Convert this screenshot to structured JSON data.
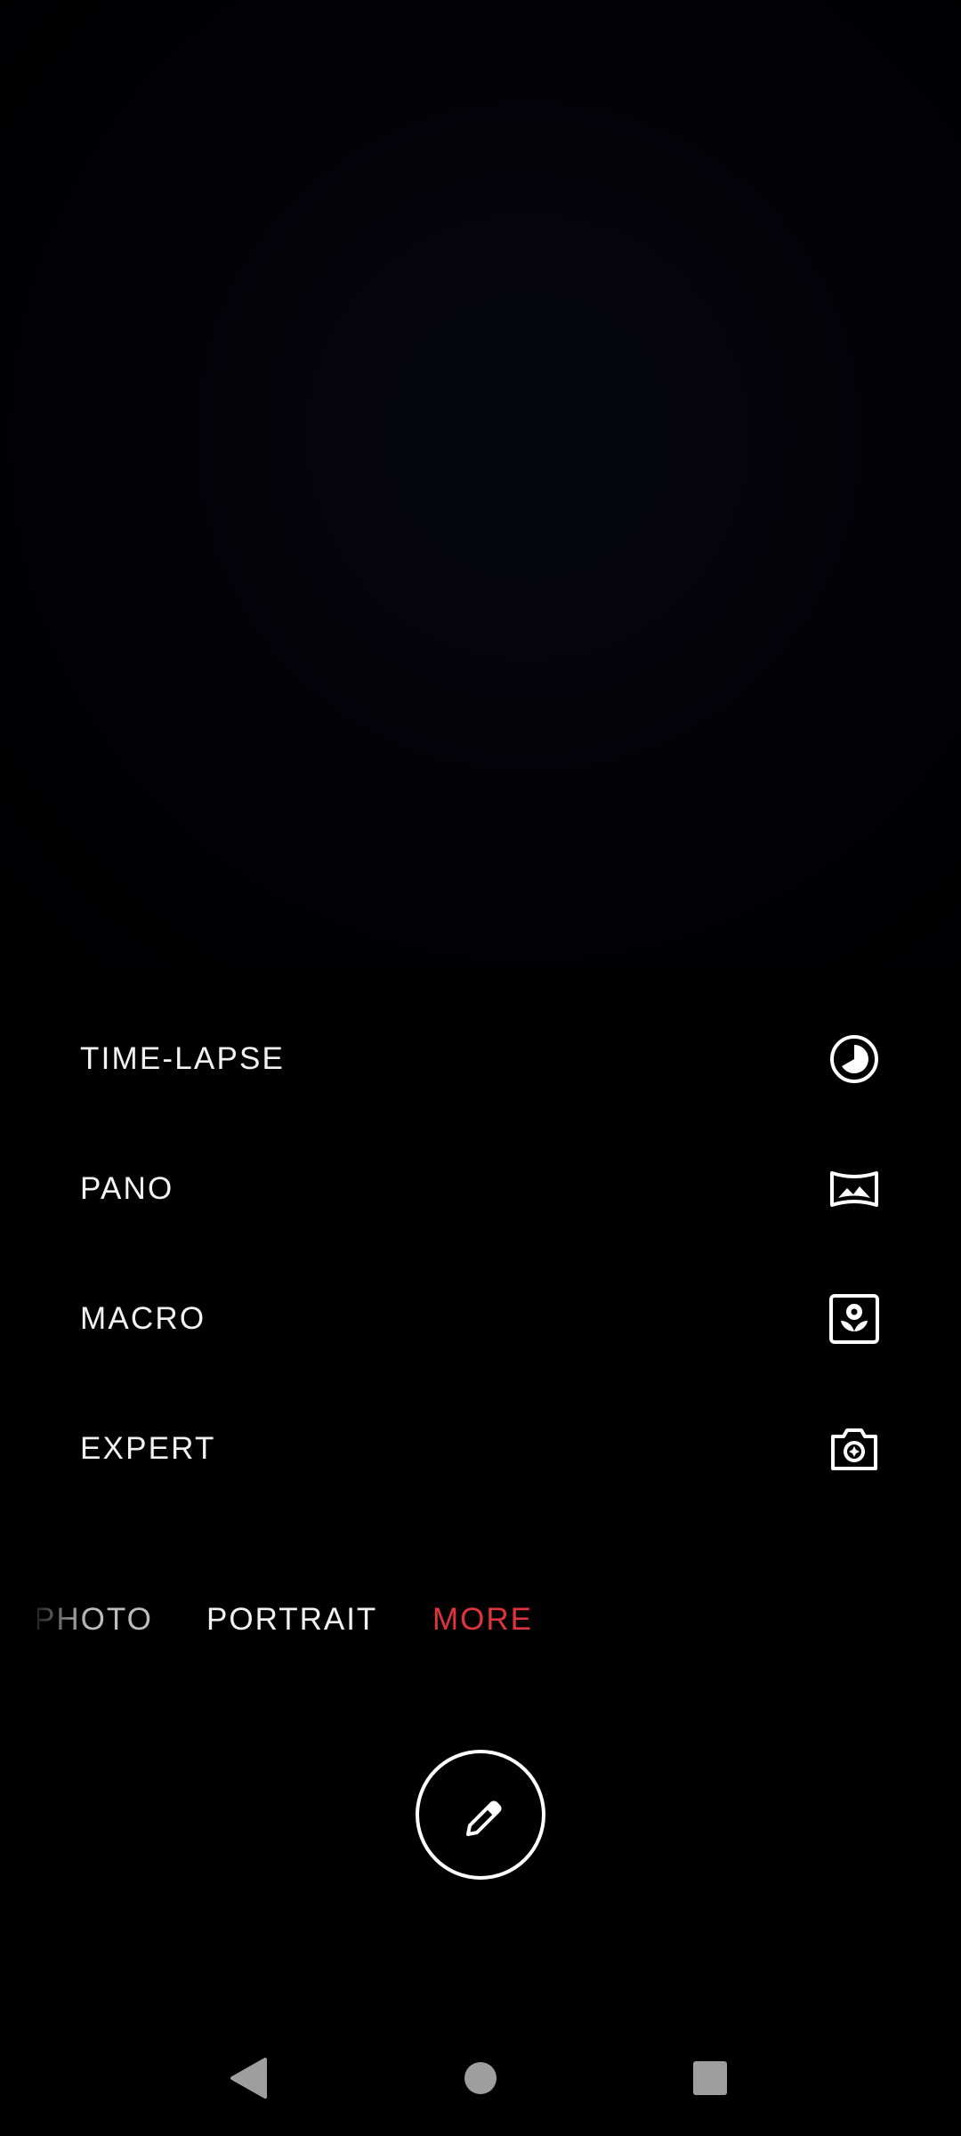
{
  "modes": [
    {
      "label": "TIME-LAPSE",
      "icon": "time-lapse-icon"
    },
    {
      "label": "PANO",
      "icon": "panorama-icon"
    },
    {
      "label": "MACRO",
      "icon": "macro-flower-icon"
    },
    {
      "label": "EXPERT",
      "icon": "expert-camera-icon"
    }
  ],
  "mode_strip": {
    "photo": "PHOTO",
    "portrait": "PORTRAIT",
    "more": "MORE"
  },
  "shutter": {
    "icon": "pencil-icon"
  },
  "nav": {
    "back_icon": "back-triangle-icon",
    "home_icon": "home-circle-icon",
    "recents_icon": "recents-square-icon"
  },
  "colors": {
    "background": "#000000",
    "text": "#f2f2f2",
    "accent": "#e0343c",
    "nav_icon": "#9e9e9e"
  }
}
